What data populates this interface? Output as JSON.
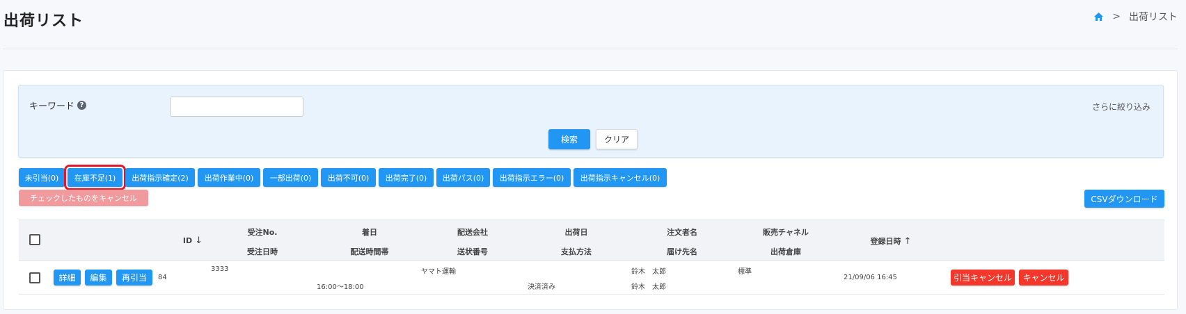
{
  "page": {
    "title": "出荷リスト"
  },
  "breadcrumb": {
    "home_icon": "home-icon",
    "separator": ">",
    "current": "出荷リスト"
  },
  "search": {
    "keyword_label": "キーワード",
    "help_icon": "?",
    "keyword_value": "",
    "more_filter": "さらに絞り込み",
    "search_button": "検索",
    "clear_button": "クリア"
  },
  "status_buttons": [
    {
      "label": "未引当(0)",
      "selected": false
    },
    {
      "label": "在庫不足(1)",
      "selected": true
    },
    {
      "label": "出荷指示確定(2)",
      "selected": false
    },
    {
      "label": "出荷作業中(0)",
      "selected": false
    },
    {
      "label": "一部出荷(0)",
      "selected": false
    },
    {
      "label": "出荷不可(0)",
      "selected": false
    },
    {
      "label": "出荷完了(0)",
      "selected": false
    },
    {
      "label": "出荷パス(0)",
      "selected": false
    },
    {
      "label": "出荷指示エラー(0)",
      "selected": false
    },
    {
      "label": "出荷指示キャンセル(0)",
      "selected": false
    }
  ],
  "actions": {
    "cancel_checked": "チェックしたものをキャンセル",
    "csv_download": "CSVダウンロード"
  },
  "table": {
    "headers": {
      "id": "ID",
      "id_sort": "↓",
      "order_no": "受注No.",
      "order_date": "受注日時",
      "arrival_date": "着日",
      "delivery_time": "配送時間帯",
      "carrier": "配送会社",
      "tracking_no": "送状番号",
      "ship_date": "出荷日",
      "payment": "支払方法",
      "orderer": "注文者名",
      "recipient": "届け先名",
      "channel": "販売チャネル",
      "warehouse": "出荷倉庫",
      "registered": "登録日時",
      "registered_sort": "↑"
    },
    "rows": [
      {
        "detail_button": "詳細",
        "edit_button": "編集",
        "reallocate_button": "再引当",
        "id": "84",
        "order_no": "3333",
        "delivery_time": "16:00～18:00",
        "carrier": "ヤマト運輸",
        "payment": "決済済み",
        "orderer": "鈴木　太郎",
        "recipient": "鈴木　太郎",
        "channel": "標準",
        "registered": "21/09/06 16:45",
        "cancel_allocation_button": "引当キャンセル",
        "cancel_button": "キャンセル"
      }
    ]
  },
  "colors": {
    "primary": "#2196f3",
    "danger": "#f4372b",
    "selected_outline": "#e0182e",
    "panel": "#e8f3fd"
  }
}
